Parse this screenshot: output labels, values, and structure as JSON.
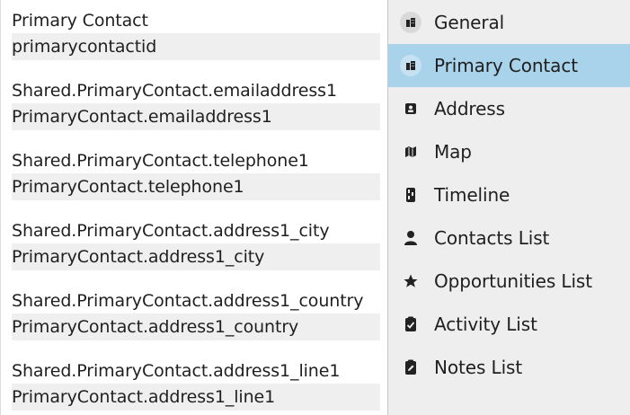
{
  "fields": [
    {
      "label": "Primary Contact",
      "value": "primarycontactid"
    },
    {
      "label": "Shared.PrimaryContact.emailaddress1",
      "value": "PrimaryContact.emailaddress1"
    },
    {
      "label": "Shared.PrimaryContact.telephone1",
      "value": "PrimaryContact.telephone1"
    },
    {
      "label": "Shared.PrimaryContact.address1_city",
      "value": "PrimaryContact.address1_city"
    },
    {
      "label": "Shared.PrimaryContact.address1_country",
      "value": "PrimaryContact.address1_country"
    },
    {
      "label": "Shared.PrimaryContact.address1_line1",
      "value": "PrimaryContact.address1_line1"
    }
  ],
  "nav": {
    "items": [
      {
        "label": "General",
        "icon": "building-icon"
      },
      {
        "label": "Primary Contact",
        "icon": "building-icon",
        "active": true
      },
      {
        "label": "Address",
        "icon": "address-card-icon"
      },
      {
        "label": "Map",
        "icon": "map-icon"
      },
      {
        "label": "Timeline",
        "icon": "timeline-icon"
      },
      {
        "label": "Contacts List",
        "icon": "person-icon"
      },
      {
        "label": "Opportunities List",
        "icon": "star-icon"
      },
      {
        "label": "Activity List",
        "icon": "clipboard-check-icon"
      },
      {
        "label": "Notes List",
        "icon": "note-edit-icon"
      }
    ],
    "active_color": "#a8d3ea",
    "background": "#eeeeee"
  }
}
